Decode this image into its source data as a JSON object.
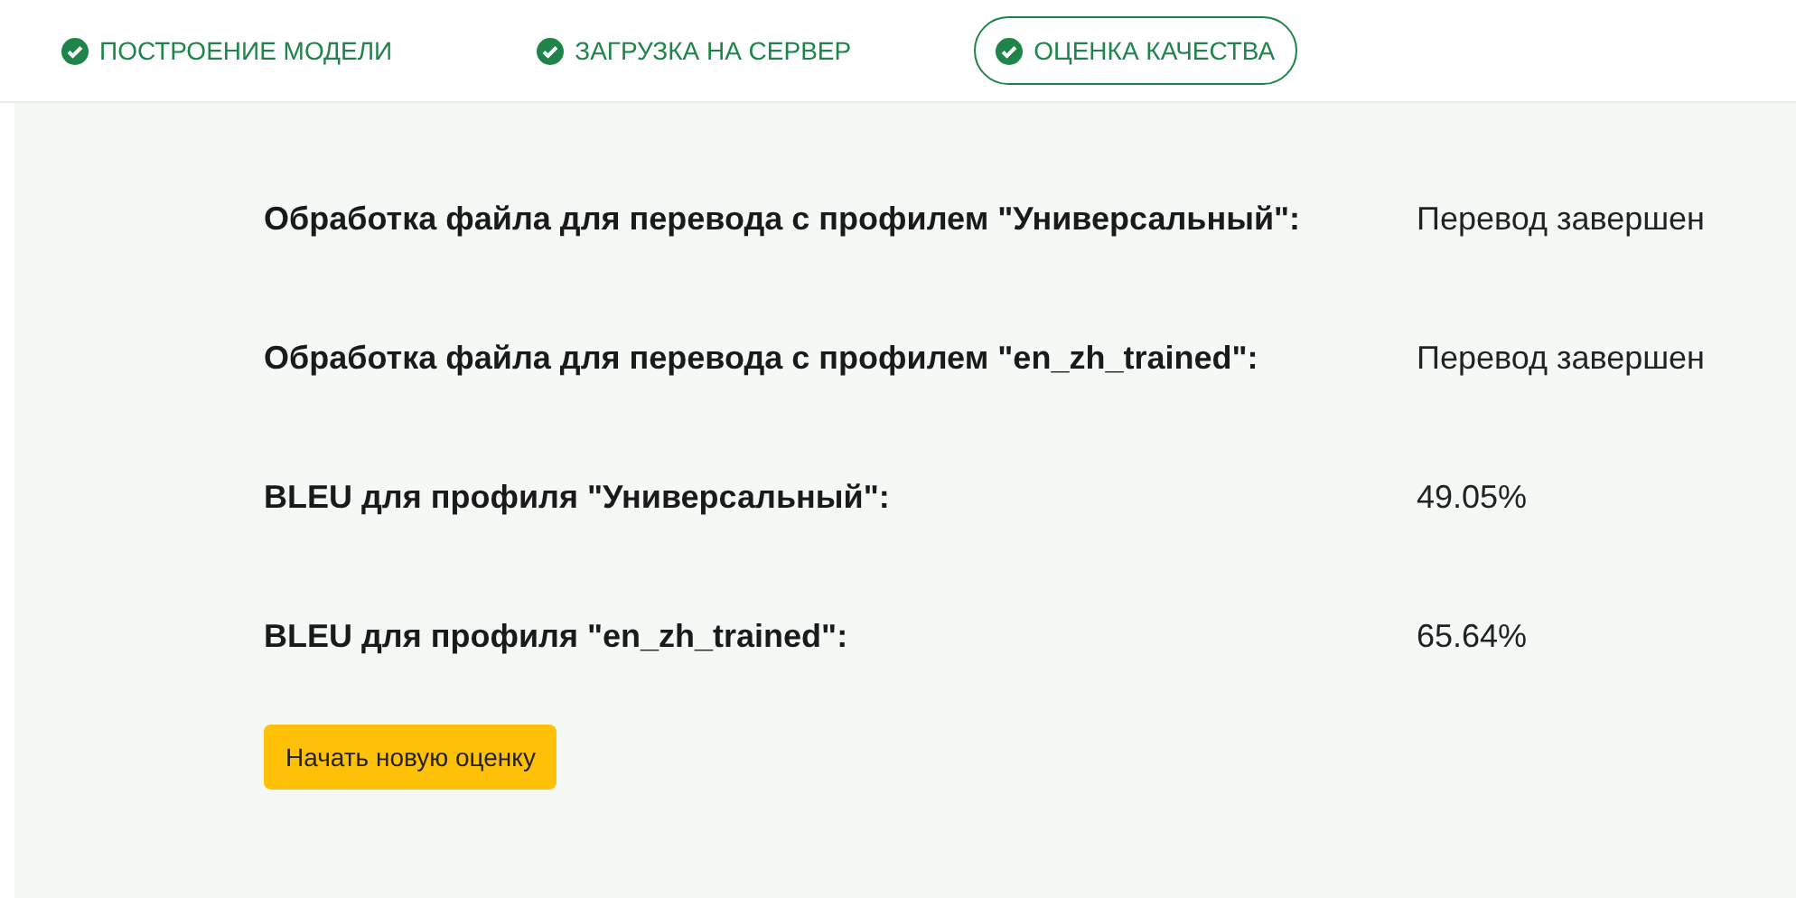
{
  "steps": [
    {
      "label": "ПОСТРОЕНИЕ МОДЕЛИ",
      "completed": true,
      "selected": false
    },
    {
      "label": "ЗАГРУЗКА НА СЕРВЕР",
      "completed": true,
      "selected": false
    },
    {
      "label": "ОЦЕНКА КАЧЕСТВА",
      "completed": true,
      "selected": true
    }
  ],
  "results": [
    {
      "label": "Обработка файла для перевода с профилем \"Универсальный\":",
      "value": "Перевод завершен"
    },
    {
      "label": "Обработка файла для перевода с профилем \"en_zh_trained\":",
      "value": "Перевод завершен"
    },
    {
      "label": "BLEU для профиля \"Универсальный\":",
      "value": "49.05%"
    },
    {
      "label": "BLEU для профиля \"en_zh_trained\":",
      "value": "65.64%"
    }
  ],
  "button": "Начать новую оценку"
}
